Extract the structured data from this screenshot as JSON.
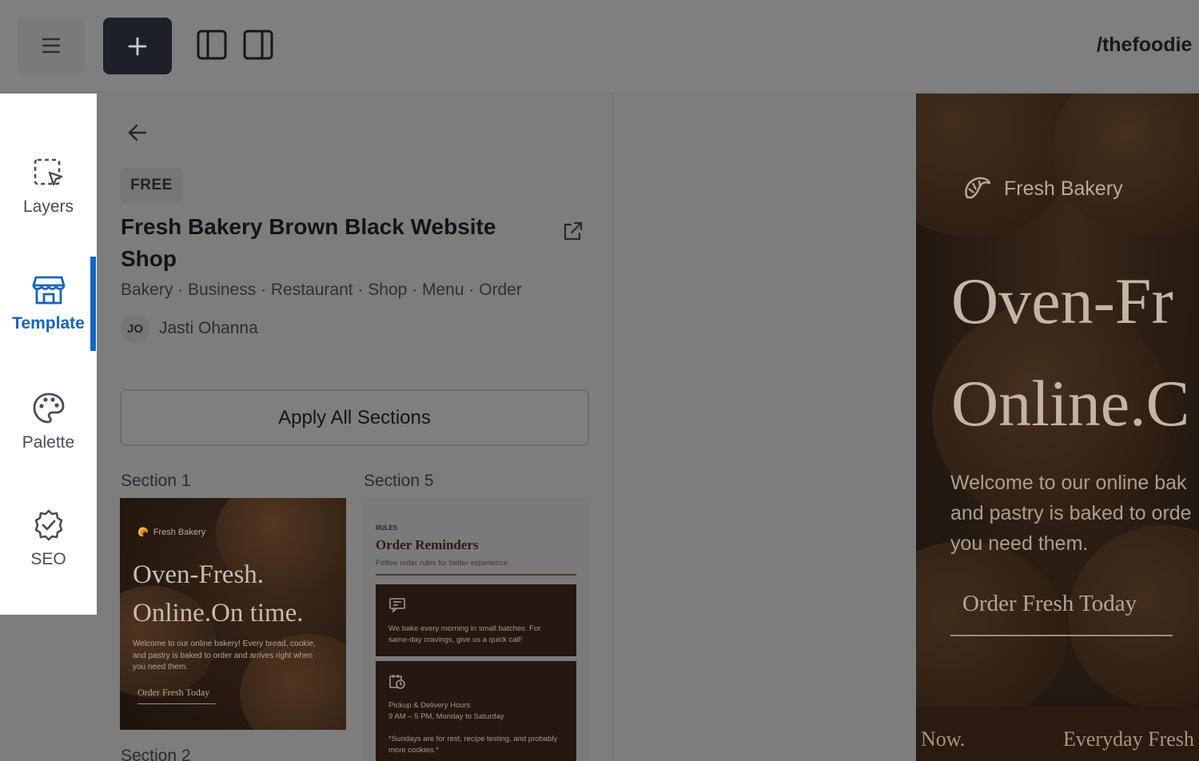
{
  "topbar": {
    "menu_icon": "hamburger-icon",
    "add_icon": "plus-icon",
    "left_panel_icon": "panel-left-icon",
    "right_panel_icon": "panel-right-icon",
    "site_path": "/thefoodie"
  },
  "rail": {
    "items": [
      {
        "label": "Layers",
        "icon": "layers-select-icon"
      },
      {
        "label": "Template",
        "icon": "store-icon",
        "active": true
      },
      {
        "label": "Palette",
        "icon": "palette-icon"
      },
      {
        "label": "SEO",
        "icon": "badge-check-icon"
      }
    ],
    "accent_color": "#1565c0"
  },
  "template": {
    "badge": "FREE",
    "title": "Fresh Bakery Brown Black Website Shop",
    "tags": "Bakery · Business · Restaurant · Shop · Menu · Order",
    "author_initials": "JO",
    "author_name": "Jasti Ohanna",
    "apply_label": "Apply All Sections",
    "sections": [
      {
        "label": "Section 1",
        "brand": "Fresh Bakery",
        "headline_1": "Oven-Fresh.",
        "headline_2": "Online.On time.",
        "body": "Welcome to our online bakery! Every bread, cookie, and pastry is baked to order and arrives right when you need them.",
        "cta": "Order Fresh Today"
      },
      {
        "label": "Section 5",
        "eyebrow": "RULES",
        "title": "Order Reminders",
        "subtitle": "Follow order rules for better experience",
        "card_1": "We bake every morning in small batches. For same-day cravings, give us a quick call!",
        "card_2_line_1": "Pickup & Delivery Hours",
        "card_2_line_2": "9 AM – 5 PM, Monday to Saturday",
        "card_2_note": "*Sundays are for rest, recipe testing, and probably more cookies.*"
      },
      {
        "label": "Section 2"
      }
    ]
  },
  "preview": {
    "brand": "Fresh Bakery",
    "headline_1": "Oven-Fr",
    "headline_2": "Online.C",
    "body_1": "Welcome to our online bak",
    "body_2": "and pastry is baked to orde",
    "body_3": "you need them.",
    "cta": "Order Fresh Today",
    "ticker_1": "Now.",
    "ticker_2": "Everyday Fresh"
  }
}
